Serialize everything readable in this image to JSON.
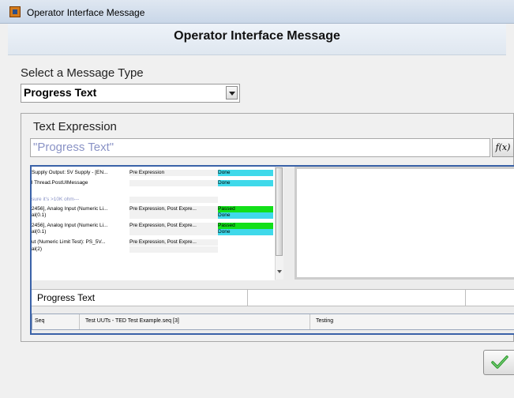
{
  "window": {
    "title": "Operator Interface Message"
  },
  "header": {
    "title": "Operator Interface Message"
  },
  "message_type": {
    "label": "Select a Message Type",
    "selected": "Progress Text"
  },
  "expression": {
    "label": "Text Expression",
    "value": "\"Progress Text\"",
    "fx_label": "f(x)"
  },
  "preview": {
    "log_rows": [
      {
        "step": "Supply Output: 5V Supply - [EN...",
        "type": "Pre Expression",
        "status": "Done",
        "status_kind": "done"
      },
      {
        "step": "l Thread.PostUIMessage",
        "type": "",
        "status": "Done",
        "status_kind": "done"
      },
      {
        "step": " sure it's >10K ohm---",
        "type": "",
        "status": "",
        "status_kind": "comment"
      },
      {
        "step": "2456], Analog Input (Numeric Li...",
        "type": "Pre Expression, Post Expre...",
        "status": "Passed",
        "status_kind": "passed"
      },
      {
        "step": "al(0.1)",
        "type": "",
        "status": "Done",
        "status_kind": "done"
      },
      {
        "step": "2456], Analog Input (Numeric Li...",
        "type": "Pre Expression, Post Expre...",
        "status": "Passed",
        "status_kind": "passed"
      },
      {
        "step": "al(0.1)",
        "type": "",
        "status": "Done",
        "status_kind": "done"
      },
      {
        "step": "ut (Numeric Limit Test): PS_5V...",
        "type": "Pre Expression, Post Expre...",
        "status": "",
        "status_kind": "none"
      },
      {
        "step": "al(2)",
        "type": "",
        "status": "",
        "status_kind": "none"
      }
    ],
    "progress_label": "Progress Text",
    "status_bar": {
      "seq_label": "Seq",
      "seq_file": "Test UUTs - TED Test Example.seq [3]",
      "state": "Testing"
    }
  },
  "buttons": {
    "ok_icon": "checkmark-icon"
  },
  "colors": {
    "done": "#3fd9ea",
    "passed": "#12e019",
    "selection_border": "#3a62a8",
    "expression_text": "#8a93c6"
  }
}
